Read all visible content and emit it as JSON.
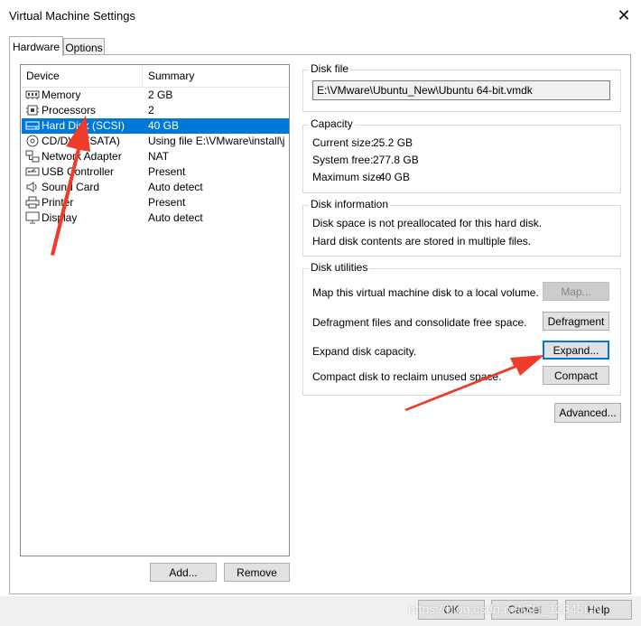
{
  "window": {
    "title": "Virtual Machine Settings",
    "close_glyph": "✕"
  },
  "tabs": [
    {
      "label": "Hardware"
    },
    {
      "label": "Options"
    }
  ],
  "device_list": {
    "columns": {
      "device": "Device",
      "summary": "Summary"
    },
    "rows": [
      {
        "device": "Memory",
        "summary": "2 GB",
        "icon": "memory-icon"
      },
      {
        "device": "Processors",
        "summary": "2",
        "icon": "processor-icon"
      },
      {
        "device": "Hard Disk (SCSI)",
        "summary": "40 GB",
        "icon": "hard-disk-icon",
        "selected": true
      },
      {
        "device": "CD/DVD (SATA)",
        "summary": "Using file E:\\VMware\\install\\ji...",
        "icon": "cd-dvd-icon"
      },
      {
        "device": "Network Adapter",
        "summary": "NAT",
        "icon": "network-adapter-icon"
      },
      {
        "device": "USB Controller",
        "summary": "Present",
        "icon": "usb-icon"
      },
      {
        "device": "Sound Card",
        "summary": "Auto detect",
        "icon": "speaker-icon"
      },
      {
        "device": "Printer",
        "summary": "Present",
        "icon": "printer-icon"
      },
      {
        "device": "Display",
        "summary": "Auto detect",
        "icon": "monitor-icon"
      }
    ],
    "add_label": "Add...",
    "remove_label": "Remove"
  },
  "disk_file": {
    "label": "Disk file",
    "value": "E:\\VMware\\Ubuntu_New\\Ubuntu 64-bit.vmdk"
  },
  "capacity": {
    "label": "Capacity",
    "current_label": "Current size:",
    "current_value": "25.2 GB",
    "free_label": "System free:",
    "free_value": "277.8 GB",
    "max_label": "Maximum size:",
    "max_value": "40 GB"
  },
  "disk_info": {
    "label": "Disk information",
    "line1": "Disk space is not preallocated for this hard disk.",
    "line2": "Hard disk contents are stored in multiple files."
  },
  "disk_utilities": {
    "label": "Disk utilities",
    "map_text": "Map this virtual machine disk to a local volume.",
    "map_button": "Map...",
    "defrag_text": "Defragment files and consolidate free space.",
    "defrag_button": "Defragment",
    "expand_text": "Expand disk capacity.",
    "expand_button": "Expand...",
    "compact_text": "Compact disk to reclaim unused space.",
    "compact_button": "Compact"
  },
  "advanced_label": "Advanced...",
  "footer": {
    "ok_label": "OK",
    "cancel_label": "Cancel",
    "help_label": "Help"
  },
  "watermark": "https://blog.csdn.net/ZH_12345DN",
  "colors": {
    "selection": "#0078d7",
    "annotation_arrow": "#ee3b2a"
  }
}
